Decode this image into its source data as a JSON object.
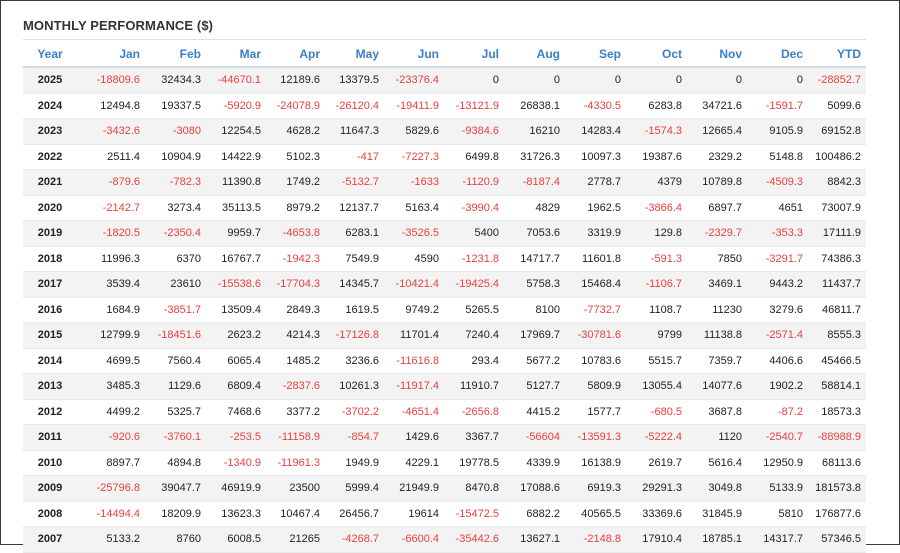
{
  "title": "MONTHLY PERFORMANCE ($)",
  "colors": {
    "header": "#3a7fc9",
    "negative": "#e8413e",
    "positive": "#222222",
    "stripe": "#f3f3f3"
  },
  "columns": [
    "Year",
    "Jan",
    "Feb",
    "Mar",
    "Apr",
    "May",
    "Jun",
    "Jul",
    "Aug",
    "Sep",
    "Oct",
    "Nov",
    "Dec",
    "YTD"
  ],
  "rows": [
    [
      "2025",
      "-18809.6",
      "32434.3",
      "-44670.1",
      "12189.6",
      "13379.5",
      "-23376.4",
      "0",
      "0",
      "0",
      "0",
      "0",
      "0",
      "-28852.7"
    ],
    [
      "2024",
      "12494.8",
      "19337.5",
      "-5920.9",
      "-24078.9",
      "-26120.4",
      "-19411.9",
      "-13121.9",
      "26838.1",
      "-4330.5",
      "6283.8",
      "34721.6",
      "-1591.7",
      "5099.6"
    ],
    [
      "2023",
      "-3432.6",
      "-3080",
      "12254.5",
      "4628.2",
      "11647.3",
      "5829.6",
      "-9384.6",
      "16210",
      "14283.4",
      "-1574.3",
      "12665.4",
      "9105.9",
      "69152.8"
    ],
    [
      "2022",
      "2511.4",
      "10904.9",
      "14422.9",
      "5102.3",
      "-417",
      "-7227.3",
      "6499.8",
      "31726.3",
      "10097.3",
      "19387.6",
      "2329.2",
      "5148.8",
      "100486.2"
    ],
    [
      "2021",
      "-879.6",
      "-782.3",
      "11390.8",
      "1749.2",
      "-5132.7",
      "-1633",
      "-1120.9",
      "-8187.4",
      "2778.7",
      "4379",
      "10789.8",
      "-4509.3",
      "8842.3"
    ],
    [
      "2020",
      "-2142.7",
      "3273.4",
      "35113.5",
      "8979.2",
      "12137.7",
      "5163.4",
      "-3990.4",
      "4829",
      "1962.5",
      "-3866.4",
      "6897.7",
      "4651",
      "73007.9"
    ],
    [
      "2019",
      "-1820.5",
      "-2350.4",
      "9959.7",
      "-4653.8",
      "6283.1",
      "-3526.5",
      "5400",
      "7053.6",
      "3319.9",
      "129.8",
      "-2329.7",
      "-353.3",
      "17111.9"
    ],
    [
      "2018",
      "11996.3",
      "6370",
      "16767.7",
      "-1942.3",
      "7549.9",
      "4590",
      "-1231.8",
      "14717.7",
      "11601.8",
      "-591.3",
      "7850",
      "-3291.7",
      "74386.3"
    ],
    [
      "2017",
      "3539.4",
      "23610",
      "-15538.6",
      "-17704.3",
      "14345.7",
      "-10421.4",
      "-19425.4",
      "5758.3",
      "15468.4",
      "-1106.7",
      "3469.1",
      "9443.2",
      "11437.7"
    ],
    [
      "2016",
      "1684.9",
      "-3851.7",
      "13509.4",
      "2849.3",
      "1619.5",
      "9749.2",
      "5265.5",
      "8100",
      "-7732.7",
      "1108.7",
      "11230",
      "3279.6",
      "46811.7"
    ],
    [
      "2015",
      "12799.9",
      "-18451.6",
      "2623.2",
      "4214.3",
      "-17126.8",
      "11701.4",
      "7240.4",
      "17969.7",
      "-30781.6",
      "9799",
      "11138.8",
      "-2571.4",
      "8555.3"
    ],
    [
      "2014",
      "4699.5",
      "7560.4",
      "6065.4",
      "1485.2",
      "3236.6",
      "-11616.8",
      "293.4",
      "5677.2",
      "10783.6",
      "5515.7",
      "7359.7",
      "4406.6",
      "45466.5"
    ],
    [
      "2013",
      "3485.3",
      "1129.6",
      "6809.4",
      "-2837.6",
      "10261.3",
      "-11917.4",
      "11910.7",
      "5127.7",
      "5809.9",
      "13055.4",
      "14077.6",
      "1902.2",
      "58814.1"
    ],
    [
      "2012",
      "4499.2",
      "5325.7",
      "7468.6",
      "3377.2",
      "-3702.2",
      "-4651.4",
      "-2656.8",
      "4415.2",
      "1577.7",
      "-680.5",
      "3687.8",
      "-87.2",
      "18573.3"
    ],
    [
      "2011",
      "-920.6",
      "-3760.1",
      "-253.5",
      "-11158.9",
      "-854.7",
      "1429.6",
      "3367.7",
      "-56604",
      "-13591.3",
      "-5222.4",
      "1120",
      "-2540.7",
      "-88988.9"
    ],
    [
      "2010",
      "8897.7",
      "4894.8",
      "-1340.9",
      "-11961.3",
      "1949.9",
      "4229.1",
      "19778.5",
      "4339.9",
      "16138.9",
      "2619.7",
      "5616.4",
      "12950.9",
      "68113.6"
    ],
    [
      "2009",
      "-25796.8",
      "39047.7",
      "46919.9",
      "23500",
      "5999.4",
      "21949.9",
      "8470.8",
      "17088.6",
      "6919.3",
      "29291.3",
      "3049.8",
      "5133.9",
      "181573.8"
    ],
    [
      "2008",
      "-14494.4",
      "18209.9",
      "13623.3",
      "10467.4",
      "26456.7",
      "19614",
      "-15472.5",
      "6882.2",
      "40565.5",
      "33369.6",
      "31845.9",
      "5810",
      "176877.6"
    ],
    [
      "2007",
      "5133.2",
      "8760",
      "6008.5",
      "21265",
      "-4268.7",
      "-6600.4",
      "-35442.6",
      "13627.1",
      "-2148.8",
      "17910.4",
      "18785.1",
      "14317.7",
      "57346.5"
    ]
  ]
}
